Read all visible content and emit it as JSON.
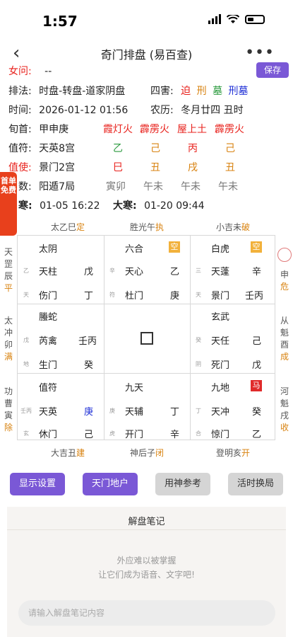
{
  "status": {
    "time": "1:57"
  },
  "nav": {
    "title": "奇门排盘 (易百查)"
  },
  "save_label": "保存",
  "promo_label": "首单免费",
  "info": {
    "nianming_label": "女问:",
    "nianming_value": "--",
    "paifa_label": "排法:",
    "paifa_value": "时盘-转盘-道家阴盘",
    "sihai_label": "四害:",
    "sihai": [
      "迫",
      "刑",
      "墓",
      "刑墓"
    ],
    "time_label": "时间:",
    "time_value": "2026-01-12 01:56",
    "nongli_label": "农历:",
    "nongli_value": "冬月廿四 丑时",
    "xunshou_label": "旬首:",
    "xunshou_value": "甲申庚",
    "xunshou_tags": [
      "霞灯火",
      "霹雳火",
      "屋上土",
      "霹雳火"
    ],
    "zhifu_label": "值符:",
    "zhifu_value": "天英8宫",
    "zhifu_tags": [
      "乙",
      "己",
      "丙",
      "己"
    ],
    "zhishi_label": "值使:",
    "zhishi_value": "景门2宫",
    "zhishi_tags": [
      "巳",
      "丑",
      "戌",
      "丑"
    ],
    "ju_label": "数:",
    "ju_value": "阳遁7局",
    "ju_tags": [
      "寅卯",
      "午未",
      "午未",
      "午未"
    ],
    "jieqi_label": "寒:",
    "jieqi_value": "01-05 16:22",
    "dahan_label": "大寒:",
    "dahan_value": "01-20 09:44"
  },
  "top_labels": [
    {
      "text": "太乙巳",
      "tag": "定"
    },
    {
      "text": "胜光午",
      "tag": "执"
    },
    {
      "text": "小吉未",
      "tag": "破"
    }
  ],
  "bottom_labels": [
    {
      "text": "大吉丑",
      "tag": "建"
    },
    {
      "text": "神后子",
      "tag": "闭"
    },
    {
      "text": "登明亥",
      "tag": "开"
    }
  ],
  "left_labels": [
    {
      "text": "天罡辰",
      "tag": "平"
    },
    {
      "text": "太冲卯",
      "tag": "满"
    },
    {
      "text": "功曹寅",
      "tag": "除"
    }
  ],
  "right_labels": [
    {
      "text": "申",
      "tag": "危"
    },
    {
      "text": "从魁酉",
      "tag": "成"
    },
    {
      "text": "河魁戌",
      "tag": "收"
    }
  ],
  "palaces": {
    "p4": {
      "shen": "太阴",
      "xing": "天柱",
      "men": "伤门",
      "tian": "戊",
      "di": "丁",
      "side1": "乙",
      "side2": "天"
    },
    "p9": {
      "shen": "六合",
      "xing": "天心",
      "men": "杜门",
      "tian": "乙",
      "di": "庚",
      "side1": "辛",
      "side2": "符",
      "badge": "空"
    },
    "p2": {
      "shen": "白虎",
      "xing": "天蓬",
      "men": "景门",
      "tian": "辛",
      "di": "壬丙",
      "side1": "三",
      "side2": "天",
      "badge": "空"
    },
    "p3": {
      "shen": "螣蛇",
      "xing": "芮禽",
      "men": "生门",
      "tian": "壬丙",
      "di": "癸",
      "side1": "戊",
      "side2": "地"
    },
    "p7": {
      "shen": "玄武",
      "xing": "天任",
      "men": "死门",
      "tian": "己",
      "di": "戊",
      "side1": "癸",
      "side2": "阴"
    },
    "p8": {
      "shen": "值符",
      "xing": "天英",
      "men": "休门",
      "tian": "庚",
      "di": "己",
      "side1": "壬丙",
      "side2": "玄"
    },
    "p1": {
      "shen": "九天",
      "xing": "天辅",
      "men": "开门",
      "tian": "丁",
      "di": "辛",
      "side1": "庚",
      "side2": "虎"
    },
    "p6": {
      "shen": "九地",
      "xing": "天冲",
      "men": "惊门",
      "tian": "癸",
      "di": "乙",
      "side1": "丁",
      "side2": "合",
      "badge": "马"
    }
  },
  "buttons": {
    "display": "显示设置",
    "tianmen": "天门地户",
    "yongshen": "用神参考",
    "huoshi": "活时换局"
  },
  "notes": {
    "title": "解盘笔记",
    "hint1": "外应难以被掌握",
    "hint2": "让它们成为语音、文字吧!",
    "placeholder": "请输入解盘笔记内容"
  },
  "colors": {
    "accent": "#7a58d6",
    "red": "#e8211c",
    "orange": "#d8820f",
    "green": "#2b9a3e",
    "blue": "#1e2fd6"
  }
}
